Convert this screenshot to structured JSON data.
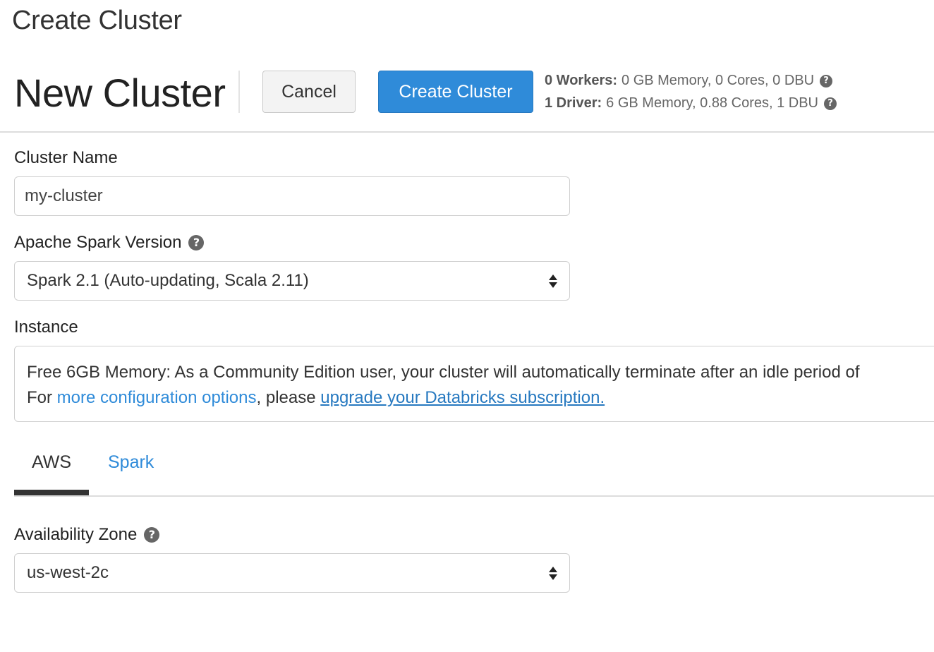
{
  "page": {
    "header": "Create Cluster"
  },
  "cluster": {
    "title": "New Cluster"
  },
  "buttons": {
    "cancel": "Cancel",
    "create": "Create Cluster"
  },
  "summary": {
    "workers_label": "0 Workers:",
    "workers_detail": "0 GB Memory, 0 Cores, 0 DBU",
    "driver_label": "1 Driver:",
    "driver_detail": "6 GB Memory, 0.88 Cores, 1 DBU"
  },
  "form": {
    "cluster_name_label": "Cluster Name",
    "cluster_name_value": "my-cluster",
    "spark_version_label": "Apache Spark Version",
    "spark_version_value": "Spark 2.1 (Auto-updating, Scala 2.11)",
    "instance_label": "Instance",
    "instance_text_line1": "Free 6GB Memory: As a Community Edition user, your cluster will automatically terminate after an idle period of",
    "instance_text_line2_prefix": "For ",
    "instance_link1": "more configuration options",
    "instance_text_line2_mid": ", please ",
    "instance_link2": "upgrade your Databricks subscription.",
    "availability_zone_label": "Availability Zone",
    "availability_zone_value": "us-west-2c"
  },
  "tabs": [
    {
      "label": "AWS",
      "active": true
    },
    {
      "label": "Spark",
      "active": false
    }
  ],
  "icons": {
    "help": "question-circle-icon",
    "select": "up-down-arrows-icon"
  },
  "colors": {
    "accent": "#2f8bd9",
    "text": "#222222",
    "muted": "#666666"
  }
}
